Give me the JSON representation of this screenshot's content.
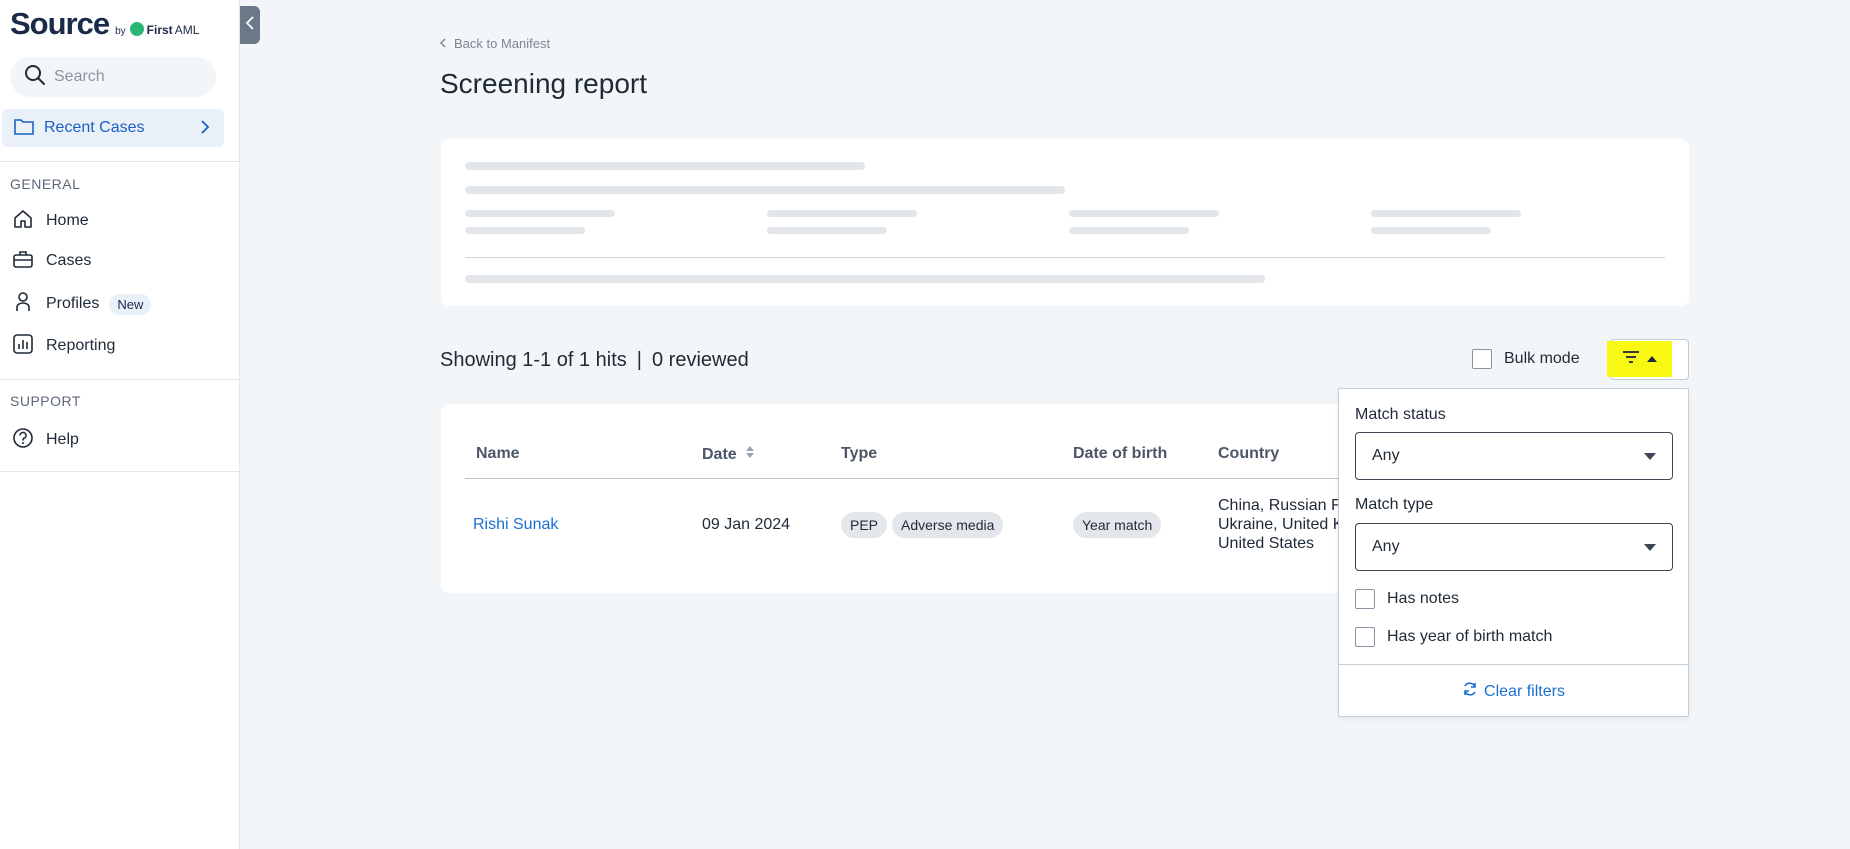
{
  "brand": {
    "name": "Source",
    "by": "by",
    "partner_first": "First",
    "partner_second": "AML"
  },
  "sidebar": {
    "search_placeholder": "Search",
    "recent_cases": "Recent Cases",
    "general_label": "GENERAL",
    "support_label": "SUPPORT",
    "items": [
      {
        "label": "Home",
        "icon": "home-icon"
      },
      {
        "label": "Cases",
        "icon": "briefcase-icon"
      },
      {
        "label": "Profiles",
        "icon": "person-icon",
        "badge": "New"
      },
      {
        "label": "Reporting",
        "icon": "chart-icon"
      }
    ],
    "help": "Help"
  },
  "main": {
    "back_link": "Back to Manifest",
    "title": "Screening report",
    "showing": "Showing 1-1 of 1 hits",
    "separator": "|",
    "reviewed": "0 reviewed",
    "bulk_mode": "Bulk mode"
  },
  "table": {
    "headers": {
      "name": "Name",
      "date": "Date",
      "type": "Type",
      "dob": "Date of birth",
      "country": "Country"
    },
    "row": {
      "name": "Rishi Sunak",
      "date": "09 Jan 2024",
      "types": [
        "PEP",
        "Adverse media"
      ],
      "dob": "Year match",
      "country_lines": [
        "China, Russian Fe",
        "Ukraine, United K",
        "United States"
      ]
    }
  },
  "filter_panel": {
    "match_status_label": "Match status",
    "match_status_value": "Any",
    "match_type_label": "Match type",
    "match_type_value": "Any",
    "has_notes": "Has notes",
    "has_yob_match": "Has year of birth match",
    "clear": "Clear filters"
  },
  "colors": {
    "accent": "#1a6fd1",
    "highlight": "#f9f714",
    "brand_green": "#2bb673"
  }
}
